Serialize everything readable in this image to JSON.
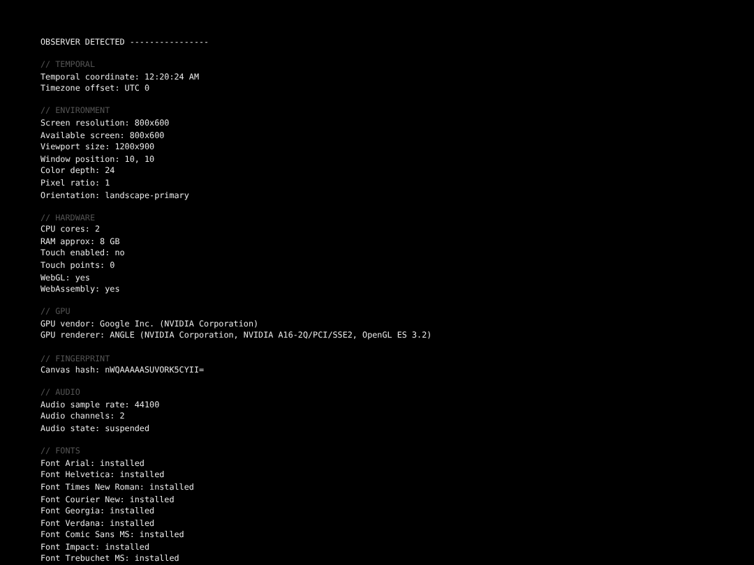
{
  "header": "OBSERVER DETECTED ----------------",
  "sections": [
    {
      "title": "// TEMPORAL",
      "lines": [
        "Temporal coordinate: 12:20:24 AM",
        "Timezone offset: UTC 0"
      ]
    },
    {
      "title": "// ENVIRONMENT",
      "lines": [
        "Screen resolution: 800x600",
        "Available screen: 800x600",
        "Viewport size: 1200x900",
        "Window position: 10, 10",
        "Color depth: 24",
        "Pixel ratio: 1",
        "Orientation: landscape-primary"
      ]
    },
    {
      "title": "// HARDWARE",
      "lines": [
        "CPU cores: 2",
        "RAM approx: 8 GB",
        "Touch enabled: no",
        "Touch points: 0",
        "WebGL: yes",
        "WebAssembly: yes"
      ]
    },
    {
      "title": "// GPU",
      "lines": [
        "GPU vendor: Google Inc. (NVIDIA Corporation)",
        "GPU renderer: ANGLE (NVIDIA Corporation, NVIDIA A16-2Q/PCI/SSE2, OpenGL ES 3.2)"
      ]
    },
    {
      "title": "// FINGERPRINT",
      "lines": [
        "Canvas hash: nWQAAAAASUVORK5CYII="
      ]
    },
    {
      "title": "// AUDIO",
      "lines": [
        "Audio sample rate: 44100",
        "Audio channels: 2",
        "Audio state: suspended"
      ]
    },
    {
      "title": "// FONTS",
      "lines": [
        "Font Arial: installed",
        "Font Helvetica: installed",
        "Font Times New Roman: installed",
        "Font Courier New: installed",
        "Font Georgia: installed",
        "Font Verdana: installed",
        "Font Comic Sans MS: installed",
        "Font Impact: installed",
        "Font Trebuchet MS: installed"
      ]
    }
  ]
}
